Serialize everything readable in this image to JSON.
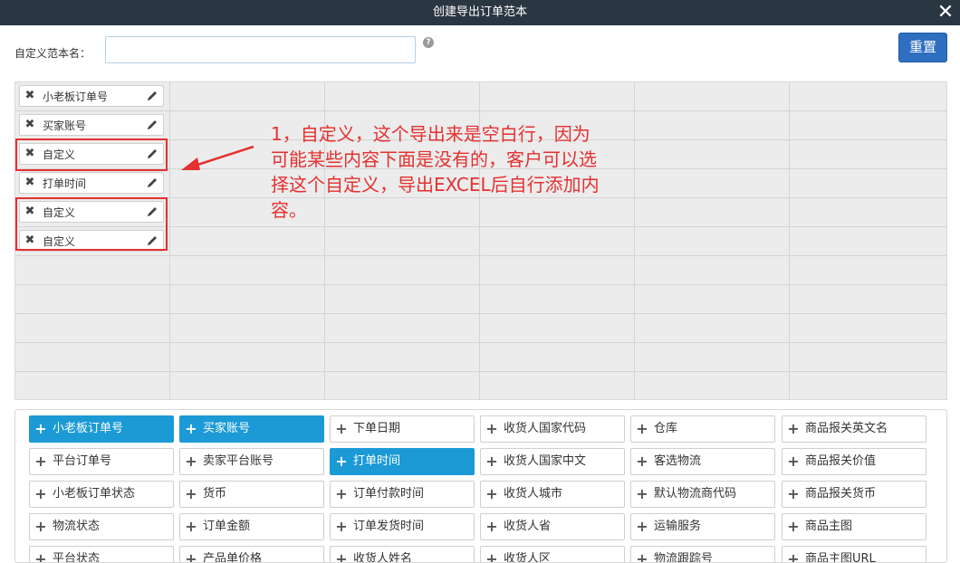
{
  "dialog": {
    "title": "创建导出订单范本"
  },
  "form": {
    "name_label": "自定义范本名：",
    "name_value": "",
    "help_symbol": "?",
    "reset_label": "重置"
  },
  "selected_fields": [
    {
      "label": "小老板订单号"
    },
    {
      "label": "买家账号"
    },
    {
      "label": "自定义"
    },
    {
      "label": "打单时间"
    },
    {
      "label": "自定义"
    },
    {
      "label": "自定义"
    }
  ],
  "annotation": {
    "lines": [
      "1，自定义，这个导出来是空白行，因为",
      "可能某些内容下面是没有的，客户可以选",
      "择这个自定义，导出EXCEL后自行添加内",
      "容。"
    ],
    "color": "#e53030"
  },
  "available_fields": [
    [
      {
        "label": "小老板订单号",
        "active": true
      },
      {
        "label": "买家账号",
        "active": true
      },
      {
        "label": "下单日期"
      },
      {
        "label": "收货人国家代码"
      },
      {
        "label": "仓库"
      },
      {
        "label": "商品报关英文名"
      }
    ],
    [
      {
        "label": "平台订单号"
      },
      {
        "label": "卖家平台账号"
      },
      {
        "label": "打单时间",
        "active": true
      },
      {
        "label": "收货人国家中文"
      },
      {
        "label": "客选物流"
      },
      {
        "label": "商品报关价值"
      }
    ],
    [
      {
        "label": "小老板订单状态"
      },
      {
        "label": "货币"
      },
      {
        "label": "订单付款时间"
      },
      {
        "label": "收货人城市"
      },
      {
        "label": "默认物流商代码"
      },
      {
        "label": "商品报关货币"
      }
    ],
    [
      {
        "label": "物流状态"
      },
      {
        "label": "订单金额"
      },
      {
        "label": "订单发货时间"
      },
      {
        "label": "收货人省"
      },
      {
        "label": "运输服务"
      },
      {
        "label": "商品主图"
      }
    ],
    [
      {
        "label": "平台状态"
      },
      {
        "label": "产品单价格"
      },
      {
        "label": "收货人姓名"
      },
      {
        "label": "收货人区"
      },
      {
        "label": "物流跟踪号"
      },
      {
        "label": "商品主图URL"
      }
    ]
  ],
  "colors": {
    "title_bar": "#2b3643",
    "primary": "#2e6fc0",
    "active_field": "#1b9ad6",
    "annotation": "#e53030"
  },
  "icons": {
    "remove": "x-icon",
    "edit": "pencil-icon",
    "add": "plus-icon",
    "close": "close-icon"
  }
}
